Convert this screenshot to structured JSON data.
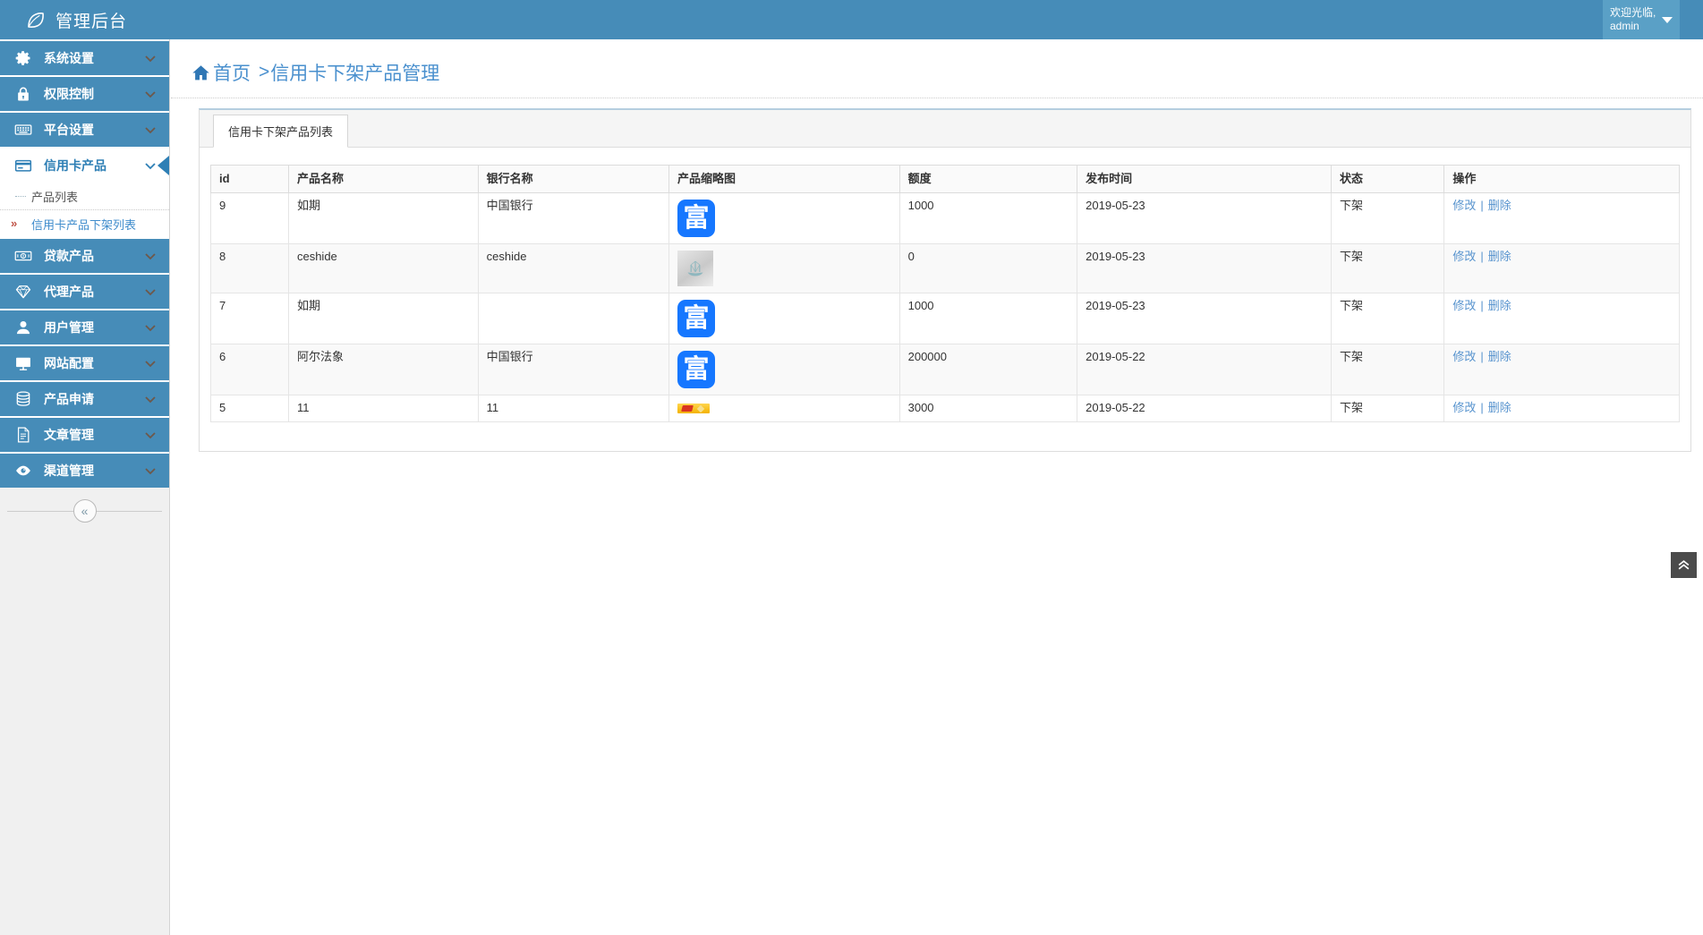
{
  "header": {
    "title": "管理后台",
    "welcome_line1": "欢迎光临,",
    "welcome_line2": "admin"
  },
  "sidebar": {
    "items": [
      {
        "key": "system-settings",
        "icon": "gear-icon",
        "label": "系统设置"
      },
      {
        "key": "permission-control",
        "icon": "lock-icon",
        "label": "权限控制"
      },
      {
        "key": "platform-settings",
        "icon": "keyboard-icon",
        "label": "平台设置"
      },
      {
        "key": "credit-card-products",
        "icon": "credit-card-icon",
        "label": "信用卡产品",
        "active": true,
        "children": [
          {
            "key": "product-list",
            "label": "产品列表"
          },
          {
            "key": "credit-card-offshelf-list",
            "label": "信用卡产品下架列表",
            "active": true
          }
        ]
      },
      {
        "key": "loan-products",
        "icon": "banknote-icon",
        "label": "贷款产品"
      },
      {
        "key": "agent-products",
        "icon": "diamond-icon",
        "label": "代理产品"
      },
      {
        "key": "user-management",
        "icon": "user-icon",
        "label": "用户管理"
      },
      {
        "key": "website-config",
        "icon": "monitor-icon",
        "label": "网站配置"
      },
      {
        "key": "product-application",
        "icon": "database-icon",
        "label": "产品申请"
      },
      {
        "key": "article-management",
        "icon": "document-icon",
        "label": "文章管理"
      },
      {
        "key": "channel-management",
        "icon": "eye-icon",
        "label": "渠道管理"
      }
    ]
  },
  "breadcrumb": {
    "home": "首页",
    "separator": ">",
    "current": "信用卡下架产品管理"
  },
  "panel": {
    "tab_label": "信用卡下架产品列表"
  },
  "table": {
    "headers": [
      "id",
      "产品名称",
      "银行名称",
      "产品缩略图",
      "额度",
      "发布时间",
      "状态",
      "操作"
    ],
    "fu_glyph": "富",
    "rows": [
      {
        "id": "9",
        "name": "如期",
        "bank": "中国银行",
        "thumb": "fu",
        "quota": "1000",
        "date": "2019-05-23",
        "status": "下架"
      },
      {
        "id": "8",
        "name": "ceshide",
        "bank": "ceshide",
        "thumb": "ship",
        "quota": "0",
        "date": "2019-05-23",
        "status": "下架"
      },
      {
        "id": "7",
        "name": "如期",
        "bank": "",
        "thumb": "fu",
        "quota": "1000",
        "date": "2019-05-23",
        "status": "下架"
      },
      {
        "id": "6",
        "name": "阿尔法象",
        "bank": "中国银行",
        "thumb": "fu",
        "quota": "200000",
        "date": "2019-05-22",
        "status": "下架"
      },
      {
        "id": "5",
        "name": "11",
        "bank": "11",
        "thumb": "banner",
        "quota": "3000",
        "date": "2019-05-22",
        "status": "下架"
      }
    ],
    "actions": {
      "edit": "修改",
      "separator": "|",
      "delete": "删除"
    },
    "sub_arrow_glyph": "»",
    "collapse_glyph": "«"
  },
  "colors": {
    "header_bg": "#468cb8",
    "welcome_bg": "#5aa0c6",
    "accent_blue": "#2e7fb5",
    "breadcrumb_blue": "#4a90ce",
    "link_blue": "#5793ce",
    "fu_icon_blue": "#1677ff",
    "sub_arrow_red": "#c05448"
  }
}
